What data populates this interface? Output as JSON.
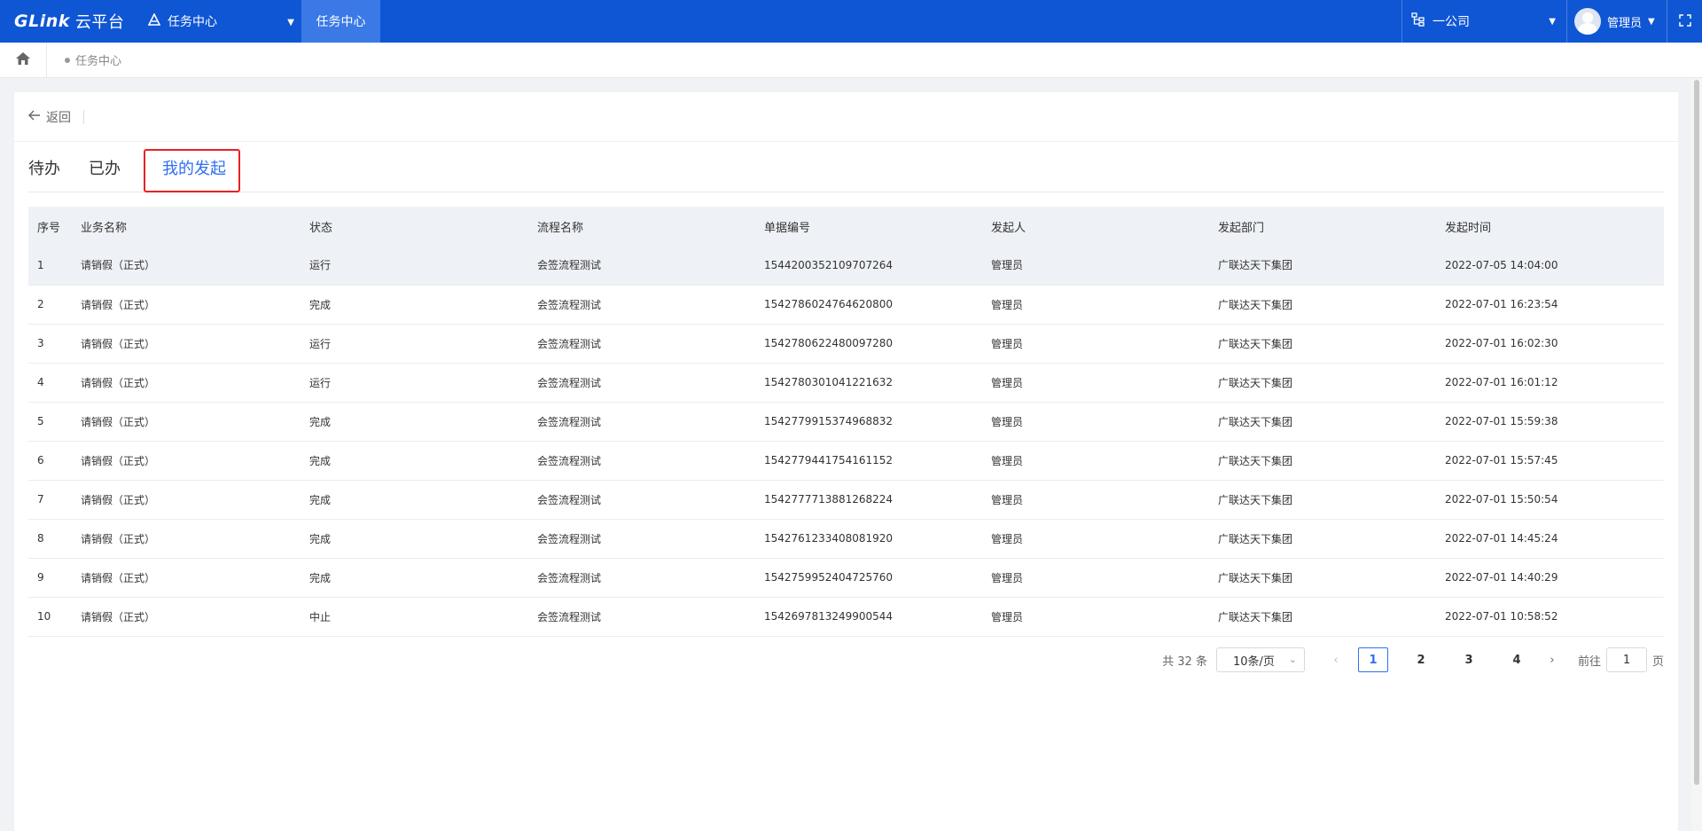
{
  "topbar": {
    "logo_text": "GLink",
    "logo_suffix": "云平台",
    "module_label": "任务中心",
    "active_tab": "任务中心",
    "org_label": "一公司",
    "user_label": "管理员"
  },
  "breadcrumb": {
    "items": [
      "任务中心"
    ]
  },
  "page": {
    "back_label": "返回",
    "tabs": [
      "待办",
      "已办",
      "我的发起"
    ],
    "active_tab": "我的发起"
  },
  "table": {
    "headers": [
      "序号",
      "业务名称",
      "状态",
      "流程名称",
      "单据编号",
      "发起人",
      "发起部门",
      "发起时间"
    ],
    "rows": [
      [
        "1",
        "请销假（正式）",
        "运行",
        "会签流程测试",
        "1544200352109707264",
        "管理员",
        "广联达天下集团",
        "2022-07-05 14:04:00"
      ],
      [
        "2",
        "请销假（正式）",
        "完成",
        "会签流程测试",
        "1542786024764620800",
        "管理员",
        "广联达天下集团",
        "2022-07-01 16:23:54"
      ],
      [
        "3",
        "请销假（正式）",
        "运行",
        "会签流程测试",
        "1542780622480097280",
        "管理员",
        "广联达天下集团",
        "2022-07-01 16:02:30"
      ],
      [
        "4",
        "请销假（正式）",
        "运行",
        "会签流程测试",
        "1542780301041221632",
        "管理员",
        "广联达天下集团",
        "2022-07-01 16:01:12"
      ],
      [
        "5",
        "请销假（正式）",
        "完成",
        "会签流程测试",
        "1542779915374968832",
        "管理员",
        "广联达天下集团",
        "2022-07-01 15:59:38"
      ],
      [
        "6",
        "请销假（正式）",
        "完成",
        "会签流程测试",
        "1542779441754161152",
        "管理员",
        "广联达天下集团",
        "2022-07-01 15:57:45"
      ],
      [
        "7",
        "请销假（正式）",
        "完成",
        "会签流程测试",
        "1542777713881268224",
        "管理员",
        "广联达天下集团",
        "2022-07-01 15:50:54"
      ],
      [
        "8",
        "请销假（正式）",
        "完成",
        "会签流程测试",
        "1542761233408081920",
        "管理员",
        "广联达天下集团",
        "2022-07-01 14:45:24"
      ],
      [
        "9",
        "请销假（正式）",
        "完成",
        "会签流程测试",
        "1542759952404725760",
        "管理员",
        "广联达天下集团",
        "2022-07-01 14:40:29"
      ],
      [
        "10",
        "请销假（正式）",
        "中止",
        "会签流程测试",
        "1542697813249900544",
        "管理员",
        "广联达天下集团",
        "2022-07-01 10:58:52"
      ]
    ]
  },
  "pagination": {
    "total_text": "共 32 条",
    "page_size": "10条/页",
    "pages": [
      "1",
      "2",
      "3",
      "4"
    ],
    "current_page": "1",
    "goto_label": "前往",
    "goto_value": "1",
    "goto_suffix": "页"
  },
  "colors": {
    "topbar_bg": "#0f56d4",
    "active_tab_text": "#2f6fef",
    "highlight_border": "#e52222"
  }
}
